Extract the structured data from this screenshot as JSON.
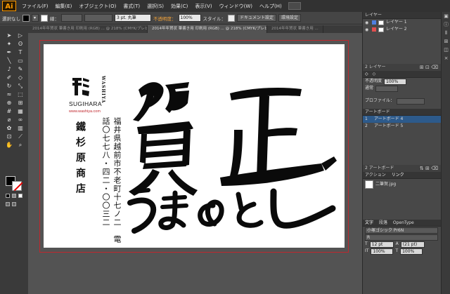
{
  "app": {
    "logo": "Ai"
  },
  "menu": {
    "items": [
      "ファイル(F)",
      "編集(E)",
      "オブジェクト(O)",
      "書式(T)",
      "選択(S)",
      "効果(C)",
      "表示(V)",
      "ウィンドウ(W)",
      "ヘルプ(H)"
    ]
  },
  "control": {
    "selection": "選択なし",
    "fill_color": "#000000",
    "stroke_label": "線：",
    "stroke_width": "",
    "brush": "3 pt. 丸筆",
    "opacity_label": "不透明度：",
    "opacity_value": "100%",
    "style_label": "スタイル：",
    "doc_setup": "ドキュメント設定",
    "env_setup": "環境設定"
  },
  "tabs": [
    "2014年年賀状 筆書き用 印刷用 (RGB) ... @ 218% (CMYK/プレビュー)",
    "2014年年賀状 筆書き用 印刷用 (RGB) ... @ 218% (CMYK/プレビュー)",
    "2014年年賀状 筆書き用 ..."
  ],
  "card": {
    "logo_char": "杉",
    "brand_vertical": "WASHIYA",
    "brand_name": "SUGIHARA",
    "url": "www.washiya.com",
    "shop_name": "鐵杉原商店",
    "address": "福井県越前市不老町十七ノ二　電話〇七七八・四二・〇〇三二",
    "greeting_line1": "賀正",
    "greeting_line2": "うまのとし"
  },
  "layers_panel": {
    "title": "レイヤー",
    "layers": [
      {
        "name": "レイヤー 1",
        "color": "#4f7fe0",
        "selected": false
      },
      {
        "name": "レイヤー 2",
        "color": "#e04f4f",
        "selected": false
      }
    ],
    "count": "2 レイヤー"
  },
  "transparency_panel": {
    "blend_label": "通常",
    "opacity_label": "不透明度",
    "opacity_value": "100%",
    "profile_label": "プロファイル："
  },
  "artboards_panel": {
    "title": "アートボード",
    "items": [
      {
        "num": "1",
        "name": "アートボード 4",
        "selected": true
      },
      {
        "name": "アートボード 5",
        "num": "2",
        "selected": false
      }
    ],
    "count": "2 アートボード"
  },
  "links_panel": {
    "tabs": [
      "アクション",
      "リンク"
    ],
    "items": [
      {
        "name": "二筆賀.jpg"
      }
    ]
  },
  "character_panel": {
    "tabs": [
      "文字",
      "段落",
      "OpenType"
    ],
    "font_family": "小塚ゴシック Pr6N",
    "font_style": "R",
    "font_size": "12 pt",
    "leading": "(21 pt)",
    "h_scale": "100%",
    "v_scale": "100%"
  },
  "colors": {
    "accent_red": "#c0272d",
    "selection_blue": "#2d5a8b",
    "ai_orange": "#ff9a00"
  }
}
